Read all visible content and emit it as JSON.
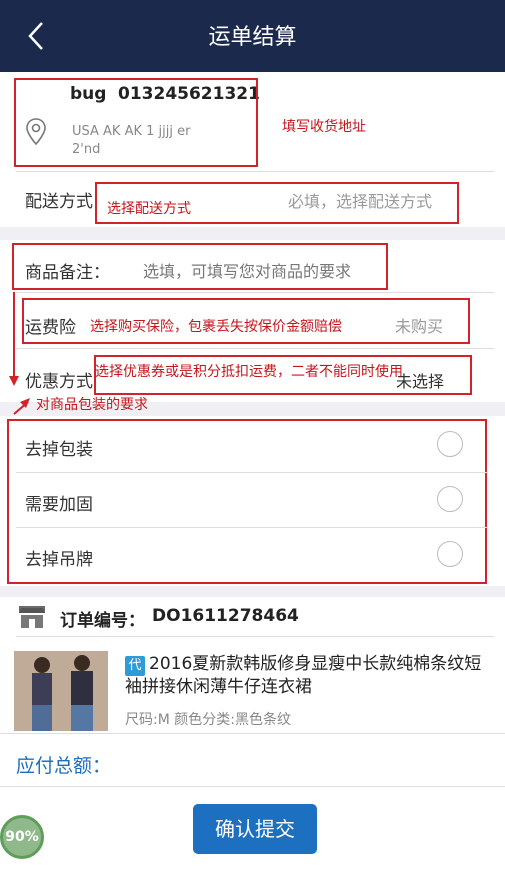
{
  "header": {
    "title": "运单结算"
  },
  "address": {
    "name": "bug",
    "phone": "013245621321",
    "line1": "USA AK AK 1 jjjj er",
    "line2": "2'nd",
    "annotation": "填写收货地址"
  },
  "shipping": {
    "label": "配送方式",
    "placeholder": "必填，选择配送方式",
    "annotation": "选择配送方式"
  },
  "remark": {
    "label": "商品备注：",
    "placeholder": "选填，可填写您对商品的要求"
  },
  "insurance": {
    "label": "运费险",
    "value": "未购买",
    "annotation": "选择购买保险，包裹丢失按保价金额赔偿"
  },
  "discount": {
    "label": "优惠方式",
    "value": "未选择",
    "annotation": "选择优惠券或是积分抵扣运费，二者不能同时使用"
  },
  "packaging": {
    "annotation": "对商品包装的要求",
    "options": [
      {
        "label": "去掉包装"
      },
      {
        "label": "需要加固"
      },
      {
        "label": "去掉吊牌"
      }
    ]
  },
  "order": {
    "number_label": "订单编号：",
    "number": "DO1611278464",
    "badge": "代",
    "product_title": "2016夏新款韩版修身显瘦中长款纯棉条纹短袖拼接休闲薄牛仔连衣裙",
    "spec": "尺码:M 颜色分类:黑色条纹"
  },
  "footer": {
    "total_label": "应付总额：",
    "submit": "确认提交",
    "progress": "90%"
  },
  "colors": {
    "navbar": "#1b2a4c",
    "accent": "#1d6fc0",
    "annotation": "#c4161c"
  }
}
